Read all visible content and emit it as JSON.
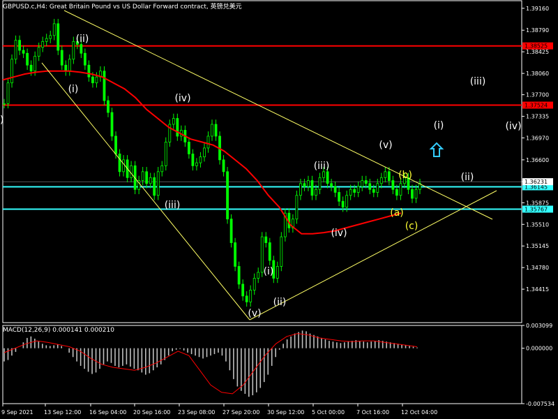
{
  "header": {
    "symbol_line": "GBPUSD.c,H4:  Great Britain Pound vs US Dollar Forward contract, 英镑兑美元"
  },
  "colors": {
    "background": "#000000",
    "bull_candle": "#00ff00",
    "ma": "#ff0000",
    "trend": "#ffff66",
    "hline_red": "#ff0000",
    "hline_cyan": "#33ffff",
    "macd_hist": "#c0c0c0",
    "macd_signal": "#ff0000",
    "wave_white": "#ffffff",
    "wave_yellow": "#ffff33",
    "arrow_cyan": "#33ccff"
  },
  "chart_data": [
    {
      "type": "candlestick",
      "title": "",
      "ylim": [
        1.3385,
        1.393
      ],
      "y_ticks": [
        "1.39160",
        "1.38790",
        "1.38425",
        "1.38060",
        "1.37700",
        "1.37335",
        "1.36970",
        "1.36600",
        "1.36231",
        "1.35875",
        "1.35510",
        "1.35145",
        "1.34780",
        "1.34415"
      ],
      "x_ticks": [
        "9 Sep 2021",
        "13 Sep 12:00",
        "16 Sep 04:00",
        "20 Sep 16:00",
        "23 Sep 08:00",
        "27 Sep 20:00",
        "30 Sep 12:00",
        "5 Oct 00:00",
        "7 Oct 16:00",
        "12 Oct 04:00"
      ],
      "close": [
        1.3755,
        1.379,
        1.383,
        1.3862,
        1.3845,
        1.384,
        1.382,
        1.381,
        1.3835,
        1.385,
        1.386,
        1.3865,
        1.387,
        1.389,
        1.3845,
        1.382,
        1.381,
        1.383,
        1.386,
        1.3855,
        1.384,
        1.382,
        1.38,
        1.379,
        1.38,
        1.381,
        1.376,
        1.374,
        1.37,
        1.367,
        1.364,
        1.366,
        1.363,
        1.365,
        1.361,
        1.3625,
        1.364,
        1.362,
        1.363,
        1.36,
        1.364,
        1.365,
        1.369,
        1.372,
        1.373,
        1.37,
        1.371,
        1.369,
        1.367,
        1.365,
        1.3655,
        1.3665,
        1.368,
        1.37,
        1.372,
        1.37,
        1.366,
        1.364,
        1.356,
        1.352,
        1.348,
        1.345,
        1.343,
        1.342,
        1.344,
        1.346,
        1.347,
        1.353,
        1.352,
        1.349,
        1.346,
        1.348,
        1.353,
        1.357,
        1.3545,
        1.356,
        1.36,
        1.362,
        1.3615,
        1.3625,
        1.36,
        1.361,
        1.363,
        1.364,
        1.362,
        1.3615,
        1.3605,
        1.359,
        1.358,
        1.36,
        1.361,
        1.3605,
        1.3615,
        1.3625,
        1.362,
        1.361,
        1.3605,
        1.362,
        1.363,
        1.364,
        1.3625,
        1.361,
        1.36,
        1.362,
        1.363,
        1.361,
        1.3595,
        1.361,
        1.362
      ],
      "ma_close": [
        1.3795,
        1.38,
        1.3805,
        1.3808,
        1.381,
        1.381,
        1.381,
        1.3808,
        1.3805,
        1.38,
        1.379,
        1.378,
        1.3765,
        1.3745,
        1.373,
        1.3715,
        1.3705,
        1.3695,
        1.369,
        1.3685,
        1.3675,
        1.366,
        1.3645,
        1.3625,
        1.36,
        1.358,
        1.355,
        1.3535,
        1.3535,
        1.3537,
        1.354,
        1.3545,
        1.355,
        1.3555,
        1.356,
        1.3565,
        1.357
      ],
      "horizontal_lines": [
        {
          "label": "1.38525",
          "value": 1.38525,
          "color": "#ff0000"
        },
        {
          "label": "1.37524",
          "value": 1.37524,
          "color": "#ff0000"
        },
        {
          "label": "1.36145",
          "value": 1.36145,
          "color": "#33ffff"
        },
        {
          "label": "1.35767",
          "value": 1.35767,
          "color": "#33ffff"
        }
      ],
      "current_price_label": "1.36231",
      "wave_labels": [
        {
          "text": "(ii)",
          "color": "white"
        },
        {
          "text": "(i)",
          "color": "white"
        },
        {
          "text": "(iii)",
          "color": "white"
        },
        {
          "text": "(iv)",
          "color": "white"
        },
        {
          "text": "(v)",
          "color": "white"
        },
        {
          "text": "(i)",
          "color": "white"
        },
        {
          "text": "(ii)",
          "color": "white"
        },
        {
          "text": "(iii)",
          "color": "white"
        },
        {
          "text": "(iv)",
          "color": "white"
        },
        {
          "text": "(v)",
          "color": "white"
        },
        {
          "text": "(b)",
          "color": "yellow"
        },
        {
          "text": "(a)",
          "color": "yellow"
        },
        {
          "text": "(c)",
          "color": "yellow"
        },
        {
          "text": "(i)",
          "color": "white"
        },
        {
          "text": "(ii)",
          "color": "white"
        },
        {
          "text": "(iii)",
          "color": "white"
        },
        {
          "text": "(iv)",
          "color": "white"
        }
      ],
      "edge_label": ")"
    },
    {
      "type": "bar",
      "title": "MACD(12,26,9) 0.000141 0.000210",
      "ylim": [
        -0.007534,
        0.003099
      ],
      "y_ticks": [
        "0.003099",
        "0.000000",
        "-0.007534"
      ],
      "histogram": [
        -0.0018,
        -0.0016,
        -0.001,
        -0.0005,
        0.0,
        0.0008,
        0.0014,
        0.0016,
        0.0013,
        0.0009,
        0.0006,
        0.0004,
        0.0003,
        0.0004,
        0.0005,
        0.0003,
        0.0,
        -0.0006,
        -0.0012,
        -0.0018,
        -0.0024,
        -0.0028,
        -0.0032,
        -0.0035,
        -0.0033,
        -0.0028,
        -0.0022,
        -0.0018,
        -0.002,
        -0.0024,
        -0.0026,
        -0.0024,
        -0.0022,
        -0.0025,
        -0.0028,
        -0.003,
        -0.0033,
        -0.0036,
        -0.0034,
        -0.003,
        -0.0026,
        -0.0022,
        -0.0016,
        -0.001,
        -0.0004,
        -0.0002,
        -0.0001,
        -0.0003,
        -0.0006,
        -0.0008,
        -0.001,
        -0.0012,
        -0.0014,
        -0.0012,
        -0.001,
        -0.0008,
        -0.0006,
        -0.001,
        -0.0018,
        -0.003,
        -0.0042,
        -0.0052,
        -0.0058,
        -0.0062,
        -0.0066,
        -0.0064,
        -0.006,
        -0.0054,
        -0.0046,
        -0.0036,
        -0.0024,
        -0.0012,
        -0.0002,
        0.0006,
        0.0012,
        0.0016,
        0.002,
        0.0022,
        0.0024,
        0.0023,
        0.002,
        0.0018,
        0.0016,
        0.0014,
        0.0012,
        0.001,
        0.0009,
        0.0008,
        0.0007,
        0.0008,
        0.0009,
        0.001,
        0.0011,
        0.001,
        0.0009,
        0.0008,
        0.0009,
        0.001,
        0.0011,
        0.001,
        0.0009,
        0.0008,
        0.0007,
        0.0006,
        0.0005,
        0.0004,
        0.0003,
        0.0002,
        0.0001
      ],
      "signal": [
        -0.0006,
        0.0,
        0.0006,
        0.001,
        0.0008,
        0.0005,
        0.0002,
        -0.0004,
        -0.0014,
        -0.0022,
        -0.0026,
        -0.0028,
        -0.003,
        -0.0026,
        -0.002,
        -0.0012,
        -0.0004,
        -0.001,
        -0.003,
        -0.005,
        -0.006,
        -0.0062,
        -0.005,
        -0.003,
        -0.001,
        0.0006,
        0.0016,
        0.002,
        0.0018,
        0.0014,
        0.0012,
        0.001,
        0.0009,
        0.001,
        0.001,
        0.0008,
        0.0006,
        0.0004,
        0.0002
      ]
    }
  ]
}
